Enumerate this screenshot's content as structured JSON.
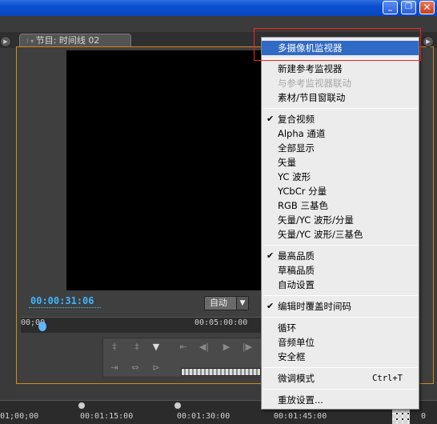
{
  "window": {
    "buttons": [
      "_",
      "❐",
      "✕"
    ]
  },
  "panel": {
    "tab_title": "节目: 时间线 02",
    "timecode": "00:00:31:06",
    "fit_label": "自动",
    "ruler_labels": [
      "00;00",
      "00:05:00:00"
    ],
    "bottom_ruler_labels": [
      "01;00;00",
      "00:01:15:00",
      "00:01:30:00",
      "00:01:45:00",
      "0"
    ]
  },
  "menu": {
    "items": [
      {
        "label": "多摄像机监视器",
        "checked": false,
        "disabled": false,
        "highlighted": true,
        "shortcut": ""
      },
      {
        "label": "新建参考监视器",
        "checked": false,
        "disabled": false,
        "highlighted": false,
        "shortcut": ""
      },
      {
        "label": "与参考监视器联动",
        "checked": false,
        "disabled": true,
        "highlighted": false,
        "shortcut": ""
      },
      {
        "label": "素材/节目窗联动",
        "checked": false,
        "disabled": false,
        "highlighted": false,
        "shortcut": ""
      },
      {
        "label": "复合视频",
        "checked": true,
        "disabled": false,
        "highlighted": false,
        "shortcut": ""
      },
      {
        "label": "Alpha 通道",
        "checked": false,
        "disabled": false,
        "highlighted": false,
        "shortcut": ""
      },
      {
        "label": "全部显示",
        "checked": false,
        "disabled": false,
        "highlighted": false,
        "shortcut": ""
      },
      {
        "label": "矢量",
        "checked": false,
        "disabled": false,
        "highlighted": false,
        "shortcut": ""
      },
      {
        "label": "YC 波形",
        "checked": false,
        "disabled": false,
        "highlighted": false,
        "shortcut": ""
      },
      {
        "label": "YCbCr 分量",
        "checked": false,
        "disabled": false,
        "highlighted": false,
        "shortcut": ""
      },
      {
        "label": "RGB 三基色",
        "checked": false,
        "disabled": false,
        "highlighted": false,
        "shortcut": ""
      },
      {
        "label": "矢量/YC 波形/分量",
        "checked": false,
        "disabled": false,
        "highlighted": false,
        "shortcut": ""
      },
      {
        "label": "矢量/YC 波形/三基色",
        "checked": false,
        "disabled": false,
        "highlighted": false,
        "shortcut": ""
      },
      {
        "label": "最高品质",
        "checked": true,
        "disabled": false,
        "highlighted": false,
        "shortcut": ""
      },
      {
        "label": "草稿品质",
        "checked": false,
        "disabled": false,
        "highlighted": false,
        "shortcut": ""
      },
      {
        "label": "自动设置",
        "checked": false,
        "disabled": false,
        "highlighted": false,
        "shortcut": ""
      },
      {
        "label": "编辑时覆盖时间码",
        "checked": true,
        "disabled": false,
        "highlighted": false,
        "shortcut": ""
      },
      {
        "label": "循环",
        "checked": false,
        "disabled": false,
        "highlighted": false,
        "shortcut": ""
      },
      {
        "label": "音频单位",
        "checked": false,
        "disabled": false,
        "highlighted": false,
        "shortcut": ""
      },
      {
        "label": "安全框",
        "checked": false,
        "disabled": false,
        "highlighted": false,
        "shortcut": ""
      },
      {
        "label": "微调模式",
        "checked": false,
        "disabled": false,
        "highlighted": false,
        "shortcut": "Ctrl+T"
      },
      {
        "label": "重放设置...",
        "checked": false,
        "disabled": false,
        "highlighted": false,
        "shortcut": ""
      }
    ]
  },
  "colors": {
    "accent": "#316ac5",
    "timecode": "#3fb6ff",
    "panel_border": "#d08a1c",
    "annotation_box": "#ff2020"
  }
}
